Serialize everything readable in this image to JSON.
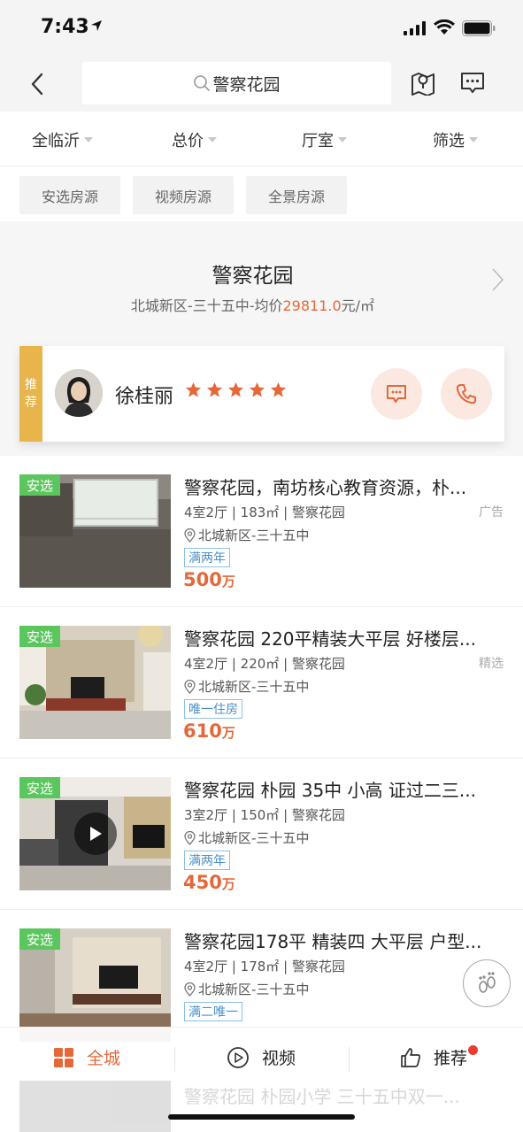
{
  "status": {
    "time": "7:43"
  },
  "search": {
    "query": "警察花园"
  },
  "filters": [
    {
      "label": "全临沂"
    },
    {
      "label": "总价"
    },
    {
      "label": "厅室"
    },
    {
      "label": "筛选"
    }
  ],
  "tags": [
    "安选房源",
    "视频房源",
    "全景房源"
  ],
  "community": {
    "name": "警察花园",
    "location": "北城新区-三十五中-均价",
    "avg_price": "29811.0",
    "price_unit": "元/㎡"
  },
  "agent": {
    "tag_line1": "推",
    "tag_line2": "荐",
    "name": "徐桂丽",
    "rating": 5
  },
  "listings": [
    {
      "badge_label": "安选",
      "title": "警察花园，南坊核心教育资源，朴...",
      "meta": "4室2厅 | 183㎡ | 警察花园",
      "right_badge": "广告",
      "location": "北城新区-三十五中",
      "tag": "满两年",
      "price": "500",
      "price_unit": "万",
      "has_video": false
    },
    {
      "badge_label": "安选",
      "title": "警察花园 220平精装大平层 好楼层...",
      "meta": "4室2厅 | 220㎡ | 警察花园",
      "right_badge": "精选",
      "location": "北城新区-三十五中",
      "tag": "唯一住房",
      "price": "610",
      "price_unit": "万",
      "has_video": false
    },
    {
      "badge_label": "安选",
      "title": "警察花园 朴园 35中 小高 证过二三...",
      "meta": "3室2厅 | 150㎡ | 警察花园",
      "right_badge": "",
      "location": "北城新区-三十五中",
      "tag": "满两年",
      "price": "450",
      "price_unit": "万",
      "has_video": true
    },
    {
      "badge_label": "安选",
      "title": "警察花园178平 精装四 大平层 户型...",
      "meta": "4室2厅 | 178㎡ | 警察花园",
      "right_badge": "",
      "location": "北城新区-三十五中",
      "tag": "满二唯一",
      "price": "",
      "price_unit": "",
      "has_video": false
    }
  ],
  "next_listing_title": "警察花园 朴园小学 三十五中双一...",
  "tabbar": {
    "items": [
      {
        "label": "全城",
        "active": true
      },
      {
        "label": "视频",
        "active": false
      },
      {
        "label": "推荐",
        "active": false
      }
    ]
  },
  "colors": {
    "accent": "#e4683a",
    "green_badge": "#5bc65e",
    "gold_tag": "#e8b54c",
    "blue_tag": "#4a90c9"
  }
}
